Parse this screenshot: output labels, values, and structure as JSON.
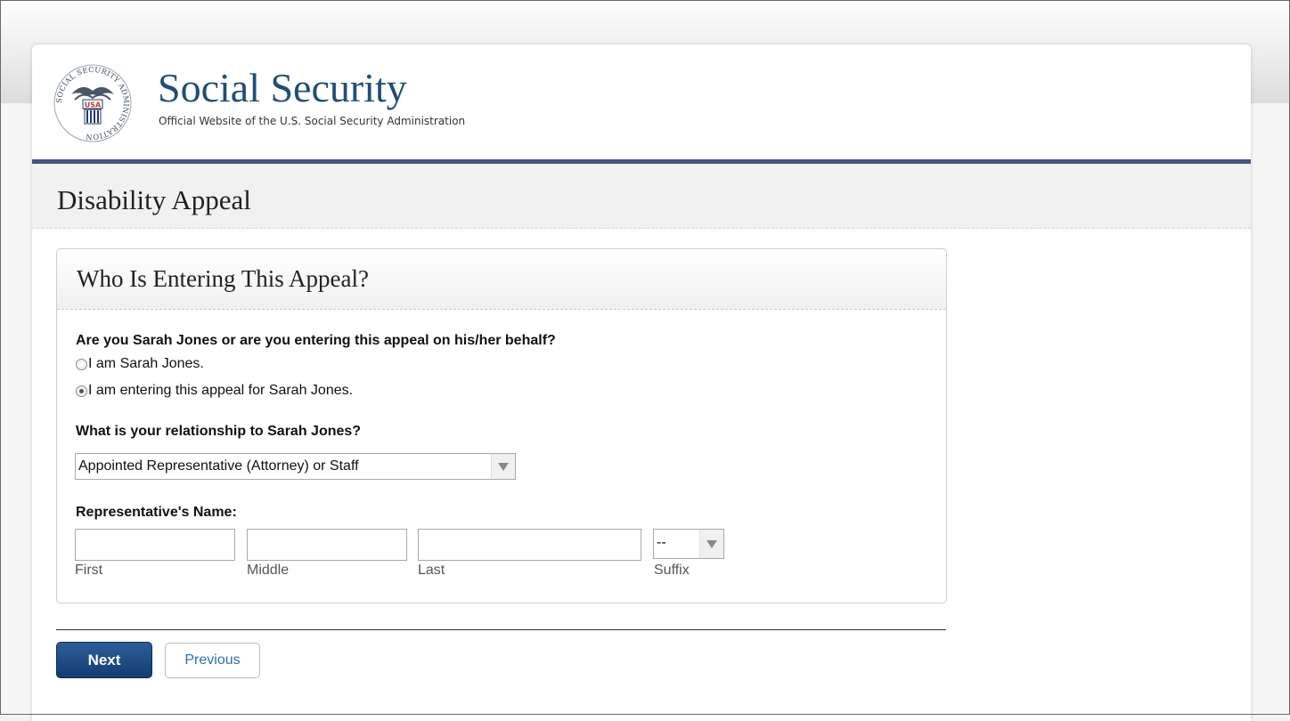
{
  "header": {
    "seal_text": "SOCIAL SECURITY ADMINISTRATION",
    "seal_badge": "USA",
    "title": "Social Security",
    "subtitle": "Official Website of the U.S. Social Security Administration"
  },
  "page": {
    "title": "Disability Appeal"
  },
  "panel": {
    "title": "Who Is Entering This Appeal?",
    "question1": "Are you Sarah Jones or are you entering this appeal on his/her behalf?",
    "options": [
      {
        "label": "I am Sarah Jones.",
        "checked": false
      },
      {
        "label": "I am entering this appeal for Sarah Jones.",
        "checked": true
      }
    ],
    "question2": "What is your relationship to Sarah Jones?",
    "relationship_value": "Appointed Representative (Attorney) or Staff",
    "name_label": "Representative's Name:",
    "fields": {
      "first": {
        "value": "",
        "label": "First"
      },
      "middle": {
        "value": "",
        "label": "Middle"
      },
      "last": {
        "value": "",
        "label": "Last"
      },
      "suffix": {
        "value": "--",
        "label": "Suffix"
      }
    }
  },
  "buttons": {
    "next": "Next",
    "previous": "Previous"
  },
  "colors": {
    "brand": "#1f4e79",
    "rule": "#45577a",
    "next_button": "#123c73",
    "link": "#2a6fb5"
  },
  "icons": {
    "seal": "ssa-seal-icon",
    "dropdown": "chevron-down-icon"
  }
}
